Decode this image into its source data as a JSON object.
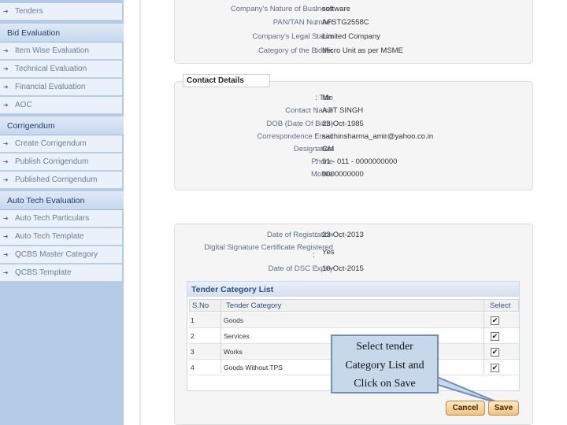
{
  "sidebar": {
    "tenders": "Tenders",
    "bid_evaluation": {
      "heading": "Bid Evaluation",
      "items": [
        "Item Wise Evaluation",
        "Technical Evaluation",
        "Financial Evaluation",
        "AOC"
      ]
    },
    "corrigendum": {
      "heading": "Corrigendum",
      "items": [
        "Create Corrigendum",
        "Publish Corrigendum",
        "Published Corrigendum"
      ]
    },
    "auto_tech": {
      "heading": "Auto Tech Evaluation",
      "items": [
        "Auto Tech Particulars",
        "Auto Tech Template",
        "QCBS Master Category",
        "QCBS Template"
      ]
    }
  },
  "company": {
    "rows": [
      {
        "label": "Company's Nature of Business",
        "value": "software"
      },
      {
        "label": "PAN/TAN Number",
        "value": "AFSTG2558C"
      },
      {
        "label": "Company's Legal Status",
        "value": "Limited Company"
      },
      {
        "label": "Category of the Bidder",
        "value": "Micro Unit as per MSME"
      }
    ]
  },
  "contact": {
    "title": "Contact Details",
    "rows": [
      {
        "label": "Title",
        "value": "Mr"
      },
      {
        "label": "Contact Name",
        "value": "AJIT SINGH"
      },
      {
        "label": "DOB (Date Of Birth)",
        "value": "23-Oct-1985"
      },
      {
        "label": "Correspondence Email",
        "value": "sachinsharma_amir@yahoo.co.in"
      },
      {
        "label": "Designation",
        "value": "GM"
      },
      {
        "label": "Phone",
        "value": "91 - 011 - 0000000000"
      },
      {
        "label": "Mobile",
        "value": "9000000000"
      }
    ]
  },
  "registration": {
    "rows": [
      {
        "label": "Date of Registration",
        "value": "23-Oct-2013"
      },
      {
        "label": "Digital Signature Certificate Registered",
        "value": "Yes"
      },
      {
        "label": "Date of DSC Expiry",
        "value": "10-Oct-2015"
      }
    ]
  },
  "tender_category": {
    "title": "Tender Category List",
    "headers": {
      "sno": "S.No",
      "category": "Tender Category",
      "select": "Select"
    },
    "rows": [
      {
        "sno": "1",
        "category": "Goods",
        "checked": true
      },
      {
        "sno": "2",
        "category": "Services",
        "checked": true
      },
      {
        "sno": "3",
        "category": "Works",
        "checked": true
      },
      {
        "sno": "4",
        "category": "Goods Without TPS",
        "checked": true
      }
    ]
  },
  "callout": {
    "line1": "Select tender",
    "line2": "Category List and",
    "line3": "Click on Save"
  },
  "buttons": {
    "cancel": "Cancel",
    "save": "Save"
  },
  "colors": {
    "sidebar": "#b3cbe6",
    "button": "#f3c37c",
    "callout": "#c7d8ea"
  }
}
